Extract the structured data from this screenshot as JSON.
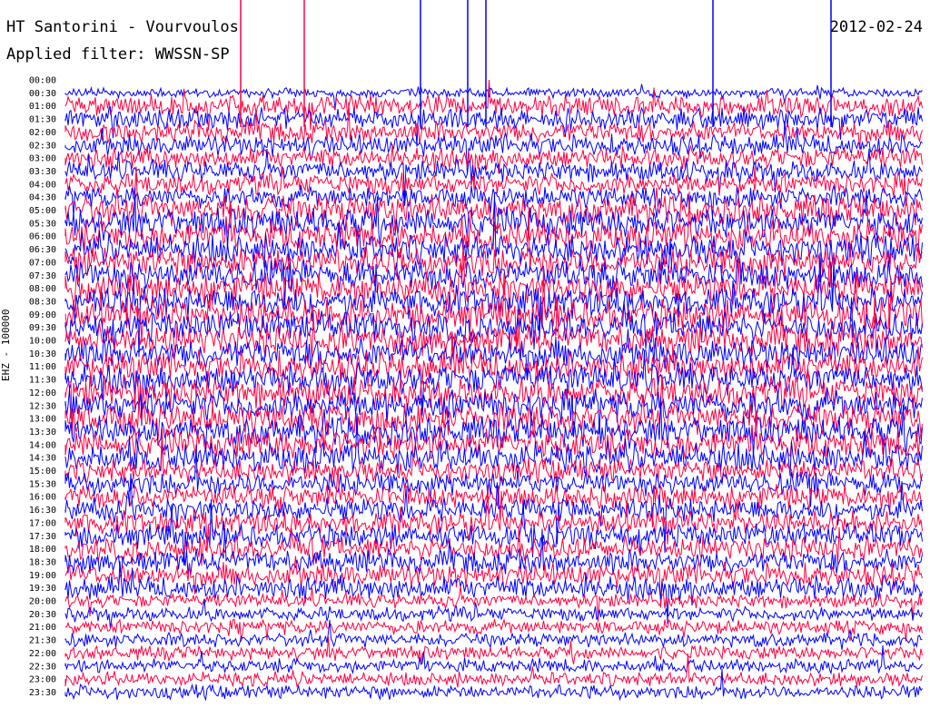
{
  "header": {
    "station": "HT Santorini - Vourvoulos",
    "filter": "Applied filter: WWSSN-SP",
    "date": "2012-02-24",
    "ylabel": "EHZ - 100000"
  },
  "colors": {
    "trace_a": "#ff0040",
    "trace_b": "#0000ff",
    "background": "#ffffff"
  },
  "chart_data": {
    "type": "line",
    "title": "HT Santorini - Vourvoulos",
    "subtitle": "Applied filter: WWSSN-SP",
    "date": "2012-02-24",
    "ylabel": "EHZ - 100000",
    "xlabel": "",
    "row_labels": [
      "00:00",
      "00:30",
      "01:00",
      "01:30",
      "02:00",
      "02:30",
      "03:00",
      "03:30",
      "04:00",
      "04:30",
      "05:00",
      "05:30",
      "06:00",
      "06:30",
      "07:00",
      "07:30",
      "08:00",
      "08:30",
      "09:00",
      "09:30",
      "10:00",
      "10:30",
      "11:00",
      "11:30",
      "12:00",
      "12:30",
      "13:00",
      "13:30",
      "14:00",
      "14:30",
      "15:00",
      "15:30",
      "16:00",
      "16:30",
      "17:00",
      "17:30",
      "18:00",
      "18:30",
      "19:00",
      "19:30",
      "20:00",
      "20:30",
      "21:00",
      "21:30",
      "22:00",
      "22:30",
      "23:00",
      "23:30"
    ],
    "series": [
      {
        "color": "#ff0040"
      },
      {
        "color": "#0000ff"
      }
    ],
    "grid": false,
    "legend": "none"
  }
}
